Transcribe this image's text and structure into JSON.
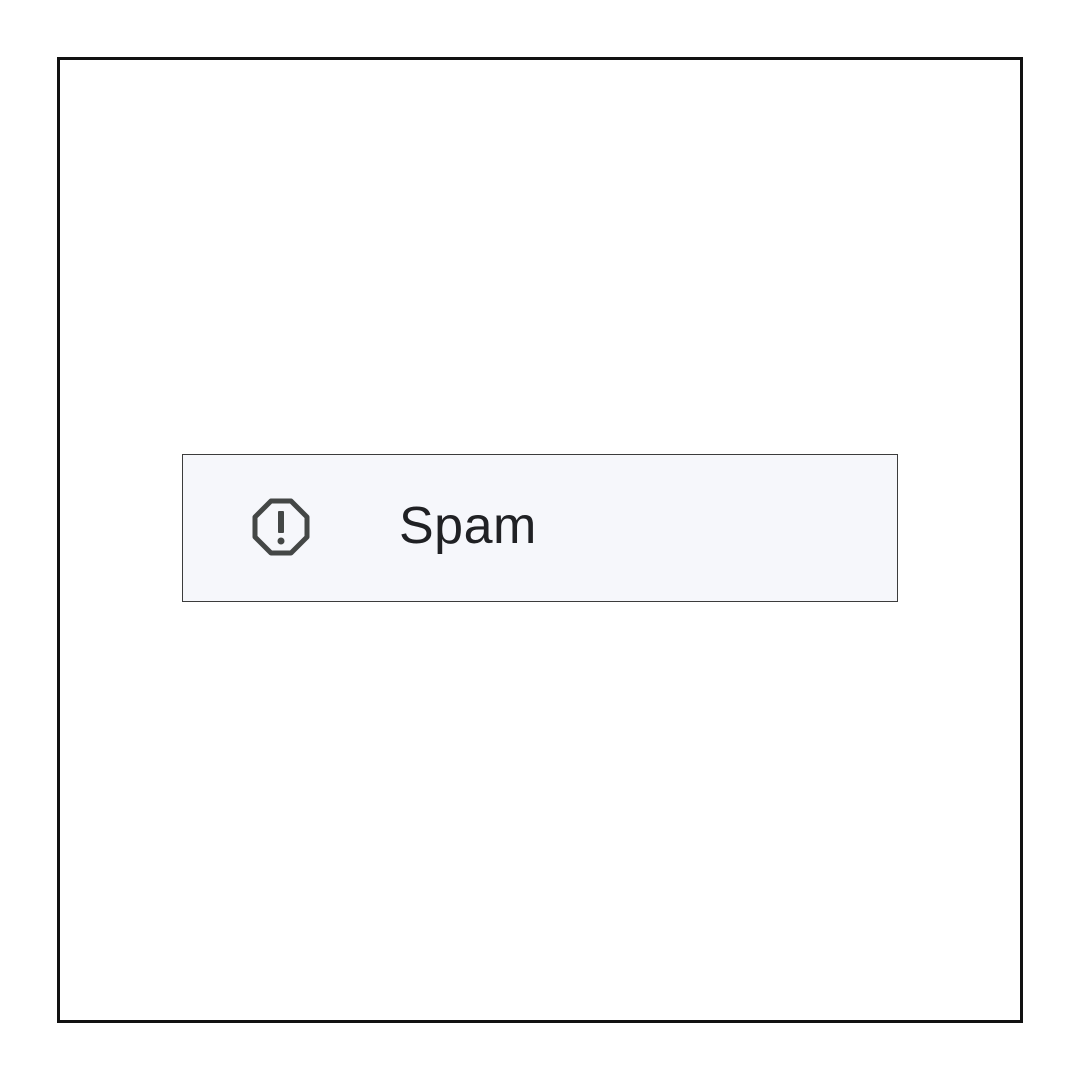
{
  "nav_item": {
    "label": "Spam",
    "icon": "report-octagon-icon",
    "background": "#f6f7fb",
    "icon_color": "#444746",
    "text_color": "#202124"
  }
}
